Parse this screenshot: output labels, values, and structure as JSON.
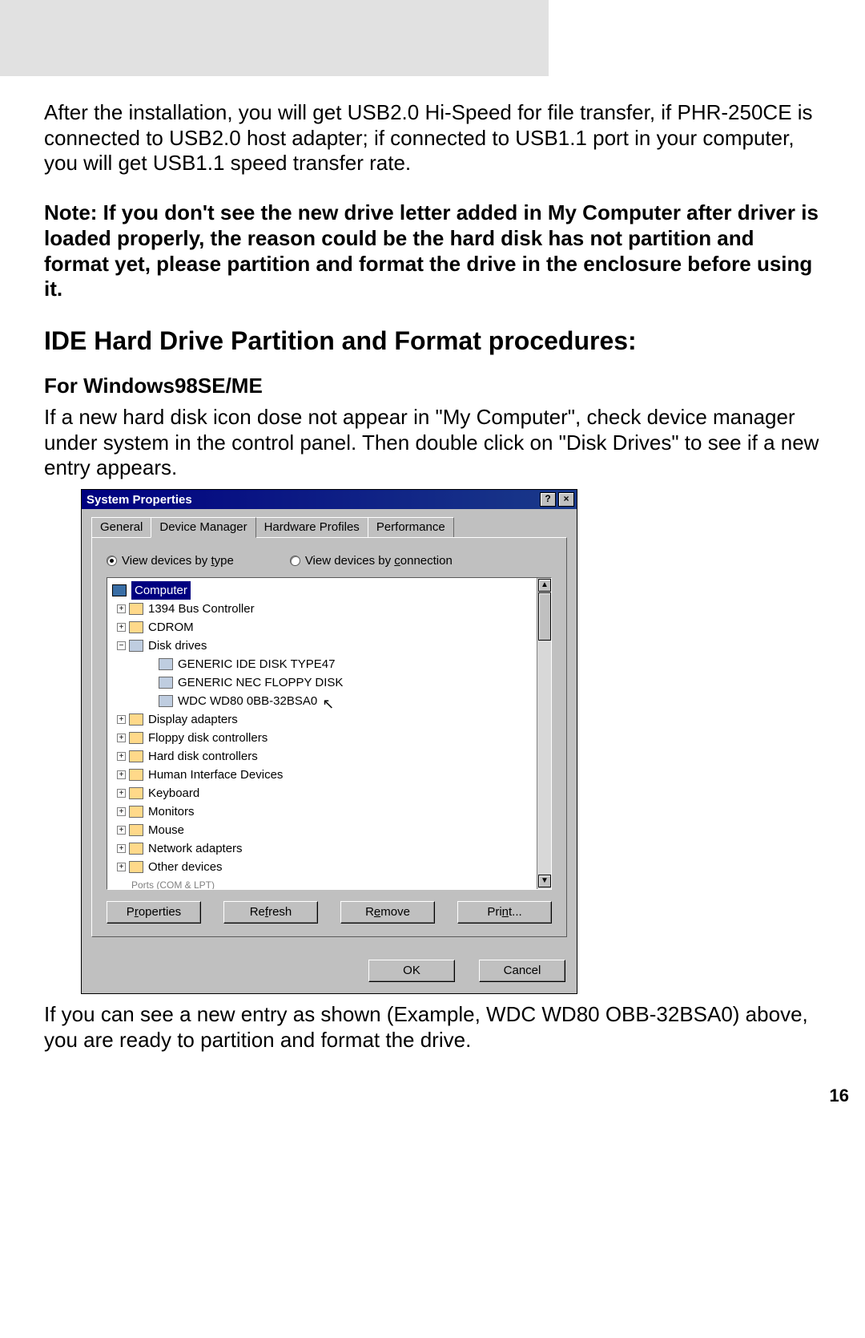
{
  "document": {
    "para1": "After the installation, you will get USB2.0 Hi-Speed for file transfer, if PHR-250CE is connected to USB2.0 host adapter; if connected to USB1.1 port in your computer, you will get USB1.1 speed transfer rate.",
    "note": "Note: If you don't see the new drive letter added in My Computer after driver is loaded properly, the reason could be the hard disk has not partition and format yet, please partition and format the drive in the enclosure before using it.",
    "section_title": "IDE Hard Drive Partition and Format procedures:",
    "subsection_title": "For Windows98SE/ME",
    "para2": "If a new hard disk icon dose not appear in \"My Computer\", check device manager under system in the control panel. Then double click on \"Disk Drives\" to see if a new entry appears.",
    "para3": "If you can see a new entry as shown (Example, WDC WD80 OBB-32BSA0) above, you are ready to partition and format the drive.",
    "page_number": "16"
  },
  "window": {
    "title": "System Properties",
    "titlebar_buttons": {
      "help": "?",
      "close": "×"
    },
    "tabs": {
      "general": "General",
      "device_manager": "Device Manager",
      "hardware_profiles": "Hardware Profiles",
      "performance": "Performance"
    },
    "radios": {
      "by_type_prefix": "View devices by ",
      "by_type_accel": "t",
      "by_type_suffix": "ype",
      "by_conn_prefix": "View devices by ",
      "by_conn_accel": "c",
      "by_conn_suffix": "onnection"
    },
    "tree": {
      "root": "Computer",
      "items": [
        "1394 Bus Controller",
        "CDROM",
        "Disk drives"
      ],
      "disk_children": [
        "GENERIC IDE  DISK TYPE47",
        "GENERIC NEC  FLOPPY DISK",
        "WDC WD80 0BB-32BSA0"
      ],
      "rest": [
        "Display adapters",
        "Floppy disk controllers",
        "Hard disk controllers",
        "Human Interface Devices",
        "Keyboard",
        "Monitors",
        "Mouse",
        "Network adapters",
        "Other devices"
      ],
      "cutoff": "Ports (COM & LPT)"
    },
    "buttons": {
      "properties_pre": "P",
      "properties_ul": "r",
      "properties_post": "operties",
      "refresh_pre": "Re",
      "refresh_ul": "f",
      "refresh_post": "resh",
      "remove_pre": "R",
      "remove_ul": "e",
      "remove_post": "move",
      "print_pre": "Pri",
      "print_ul": "n",
      "print_post": "t...",
      "ok": "OK",
      "cancel": "Cancel"
    }
  }
}
